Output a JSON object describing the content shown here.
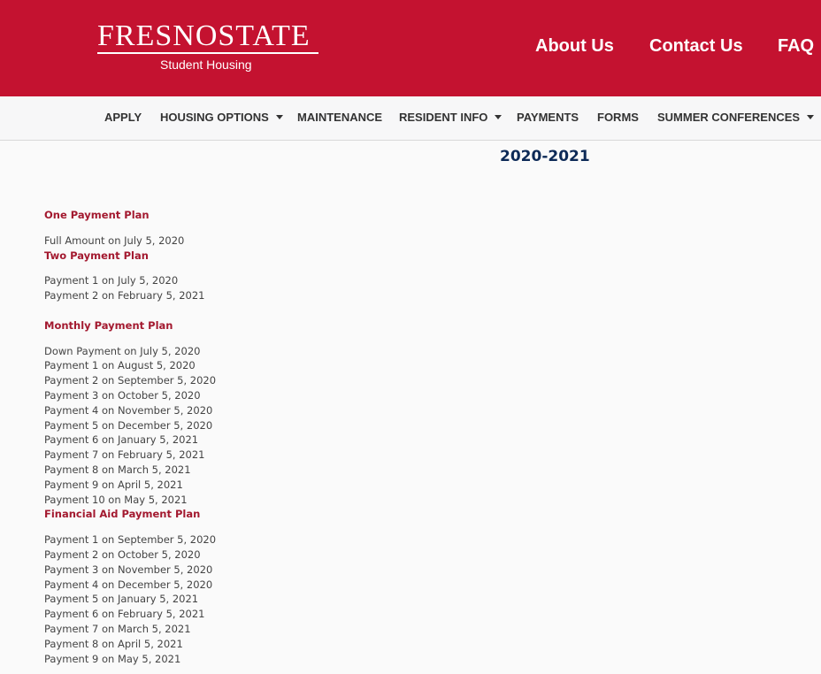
{
  "header": {
    "logo_text": "FRESNOSTATE",
    "logo_subtitle": "Student Housing",
    "links": [
      "About Us",
      "Contact Us",
      "FAQ"
    ],
    "brand_color": "#c41230"
  },
  "nav": {
    "items": [
      {
        "label": "APPLY",
        "dropdown": false
      },
      {
        "label": "HOUSING OPTIONS",
        "dropdown": true
      },
      {
        "label": "MAINTENANCE",
        "dropdown": false
      },
      {
        "label": "RESIDENT INFO",
        "dropdown": true
      },
      {
        "label": "PAYMENTS",
        "dropdown": false
      },
      {
        "label": "FORMS",
        "dropdown": false
      },
      {
        "label": "SUMMER CONFERENCES",
        "dropdown": true
      }
    ]
  },
  "main": {
    "year_heading": "2020-2021",
    "plans": [
      {
        "title": "One Payment Plan",
        "lines": [
          "Full Amount on July 5, 2020"
        ]
      },
      {
        "title": "Two Payment Plan",
        "lines": [
          "Payment 1 on July 5, 2020",
          "Payment 2 on February 5, 2021"
        ]
      },
      {
        "title": "Monthly Payment Plan",
        "lines": [
          "Down Payment on July 5, 2020",
          "Payment 1 on August 5, 2020",
          "Payment 2 on September 5, 2020",
          "Payment 3 on October 5, 2020",
          "Payment 4 on November 5, 2020",
          "Payment 5 on December 5, 2020",
          "Payment 6 on January 5, 2021",
          "Payment 7 on February 5, 2021",
          "Payment 8 on March 5, 2021",
          "Payment 9 on April 5, 2021",
          "Payment 10 on May 5, 2021"
        ]
      },
      {
        "title": "Financial Aid Payment Plan",
        "lines": [
          "Payment 1 on September 5, 2020",
          "Payment 2 on October 5, 2020",
          "Payment 3 on November 5, 2020",
          "Payment 4 on December 5, 2020",
          "Payment 5 on January 5, 2021",
          "Payment 6 on February 5, 2021",
          "Payment 7 on March 5, 2021",
          "Payment 8 on April 5, 2021",
          "Payment 9 on May 5, 2021"
        ]
      }
    ]
  }
}
